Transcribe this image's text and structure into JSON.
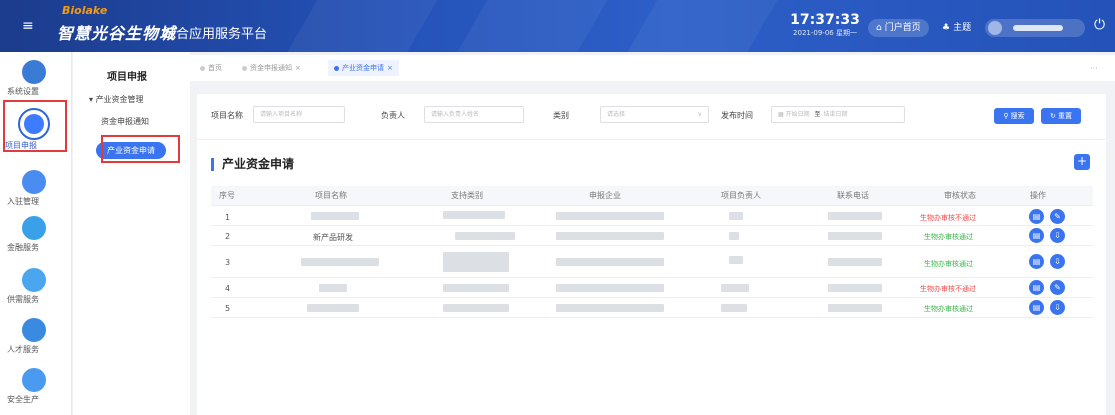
{
  "header": {
    "brand_en": "Biolake",
    "brand_cn": "智慧光谷生物城",
    "brand_sub": "综合应用服务平台",
    "time": "17:37:33",
    "date": "2021-09-06 星期一",
    "portal_label": "门户首页",
    "theme_label": "主题"
  },
  "rail": {
    "items": [
      {
        "label": "系统设置",
        "color": "#3a7bd5"
      },
      {
        "label": "项目申报",
        "color": "#3a74f0"
      },
      {
        "label": "入驻管理",
        "color": "#4a8cf0"
      },
      {
        "label": "金融服务",
        "color": "#3aa0e8"
      },
      {
        "label": "供需服务",
        "color": "#4aa6ee"
      },
      {
        "label": "人才服务",
        "color": "#3a8be0"
      },
      {
        "label": "安全生产",
        "color": "#4a9af0"
      }
    ]
  },
  "subnav": {
    "title": "项目申报",
    "group": "产业资金管理",
    "link": "资金申报通知",
    "active": "产业资金申请"
  },
  "tabs": {
    "items": [
      "首页",
      "资金申报通知",
      "产业资金申请"
    ]
  },
  "filter": {
    "name_label": "项目名称",
    "name_placeholder": "请输入项目名称",
    "owner_label": "负责人",
    "owner_placeholder": "请输入负责人姓名",
    "type_label": "类别",
    "type_placeholder": "请选择",
    "date_label": "发布时间",
    "date_start": "开始日期",
    "date_sep": "至",
    "date_end": "结束日期",
    "search_label": "搜索",
    "reset_label": "重置"
  },
  "section": {
    "title": "产业资金申请",
    "add_label": "+"
  },
  "table": {
    "headers": [
      "序号",
      "项目名称",
      "支持类别",
      "申报企业",
      "项目负责人",
      "联系电话",
      "审核状态",
      "操作"
    ],
    "rows": [
      {
        "no": "1",
        "name": "",
        "category": "",
        "company": "",
        "owner": "",
        "phone": "",
        "status": "生物办审核不通过",
        "status_type": "fail"
      },
      {
        "no": "2",
        "name": "新产品研发",
        "category": "",
        "company": "",
        "owner": "",
        "phone": "",
        "status": "生物办审核通过",
        "status_type": "pass"
      },
      {
        "no": "3",
        "name": "",
        "category": "",
        "company": "",
        "owner": "",
        "phone": "",
        "status": "生物办审核通过",
        "status_type": "pass"
      },
      {
        "no": "4",
        "name": "",
        "category": "",
        "company": "",
        "owner": "",
        "phone": "",
        "status": "生物办审核不通过",
        "status_type": "fail"
      },
      {
        "no": "5",
        "name": "",
        "category": "",
        "company": "",
        "owner": "",
        "phone": "",
        "status": "生物办审核通过",
        "status_type": "pass"
      }
    ]
  },
  "colors": {
    "accent": "#3a74f0",
    "fail": "#f04848",
    "pass": "#39b54a",
    "highlight_box": "#e23b3b"
  }
}
